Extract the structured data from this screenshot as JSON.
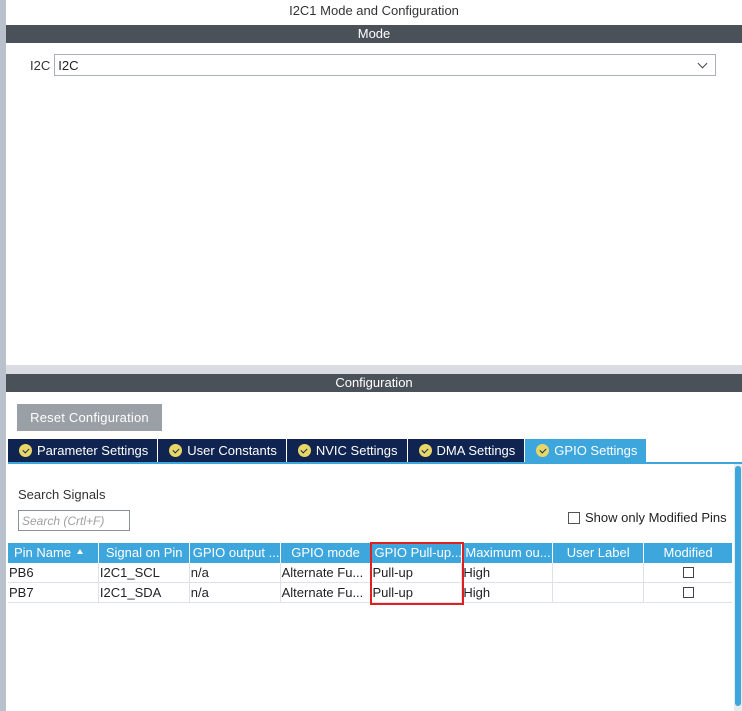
{
  "window": {
    "title": "I2C1 Mode and Configuration"
  },
  "mode_section": {
    "header": "Mode",
    "i2c_label": "I2C",
    "i2c_value": "I2C"
  },
  "config_section": {
    "header": "Configuration",
    "reset_button": "Reset Configuration",
    "tabs": [
      {
        "label": "Parameter Settings",
        "active": false
      },
      {
        "label": "User Constants",
        "active": false
      },
      {
        "label": "NVIC Settings",
        "active": false
      },
      {
        "label": "DMA Settings",
        "active": false
      },
      {
        "label": "GPIO Settings",
        "active": true
      }
    ],
    "search": {
      "label": "Search Signals",
      "placeholder": "Search (Crtl+F)",
      "value": ""
    },
    "show_modified_label": "Show only Modified Pins",
    "table": {
      "columns": [
        "Pin Name",
        "Signal on Pin",
        "GPIO output ...",
        "GPIO mode",
        "GPIO Pull-up...",
        "Maximum ou...",
        "User Label",
        "Modified"
      ],
      "rows": [
        {
          "pin": "PB6",
          "signal": "I2C1_SCL",
          "output": "n/a",
          "mode": "Alternate Fu...",
          "pull": "Pull-up",
          "max": "High",
          "label": "",
          "modified": false
        },
        {
          "pin": "PB7",
          "signal": "I2C1_SDA",
          "output": "n/a",
          "mode": "Alternate Fu...",
          "pull": "Pull-up",
          "max": "High",
          "label": "",
          "modified": false
        }
      ]
    }
  },
  "colors": {
    "section_header": "#4a5159",
    "tab_inactive": "#0f2450",
    "tab_active": "#3da6dc",
    "table_header": "#3da6dc",
    "highlight": "#e02020",
    "reset_button": "#9aa0a6"
  }
}
